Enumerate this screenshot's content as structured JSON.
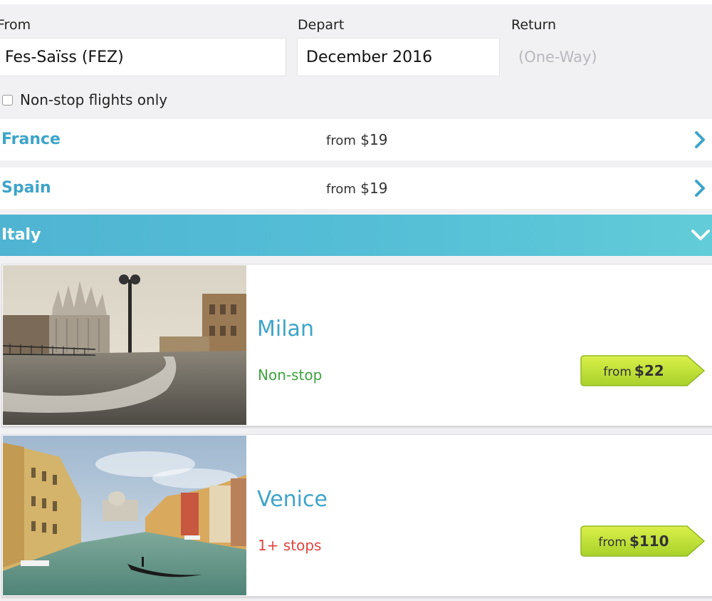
{
  "search": {
    "from_label": "From",
    "from_value": "Fes-Saïss (FEZ)",
    "depart_label": "Depart",
    "depart_value": "December 2016",
    "return_label": "Return",
    "return_placeholder": "(One-Way)",
    "nonstop_label": "Non-stop flights only",
    "nonstop_checked": false
  },
  "countries": [
    {
      "name": "France",
      "price_prefix": "from",
      "price": "$19",
      "expanded": false
    },
    {
      "name": "Spain",
      "price_prefix": "from",
      "price": "$19",
      "expanded": false
    },
    {
      "name": "Italy",
      "expanded": true
    }
  ],
  "destinations": [
    {
      "city": "Milan",
      "stops": "Non-stop",
      "price_prefix": "from",
      "price": "$22",
      "stops_color": "#3da33d"
    },
    {
      "city": "Venice",
      "stops": "1+ stops",
      "price_prefix": "from",
      "price": "$110",
      "stops_color": "#e0453f"
    }
  ],
  "colors": {
    "accent_blue": "#3ea4c9",
    "price_tag_green": "#b7dc2a",
    "header_gradient_start": "#4fb4d2",
    "header_gradient_end": "#62ccd8"
  },
  "icons": {
    "expand": "chevron-right-icon",
    "collapse": "chevron-down-icon"
  }
}
